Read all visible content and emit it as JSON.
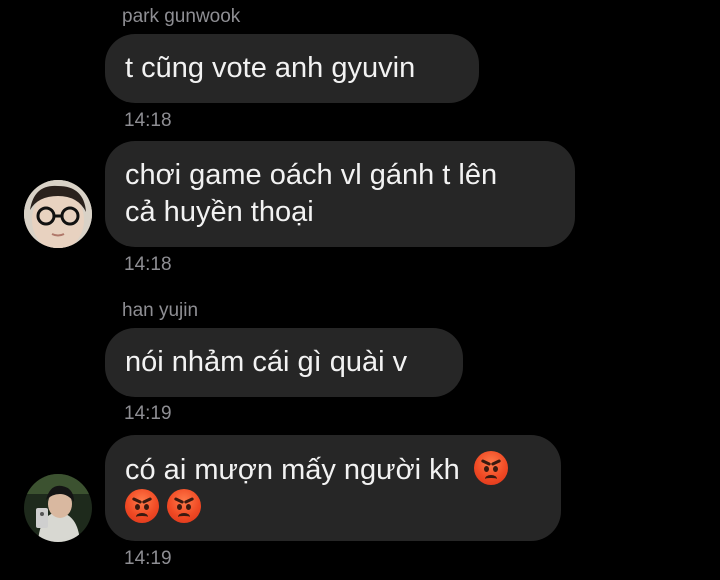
{
  "messages": [
    {
      "sender": "park gunwook",
      "text_lines": [
        "t cũng vote anh gyuvin"
      ],
      "time": "14:18"
    },
    {
      "sender": "",
      "text_lines": [
        "chơi game oách vl gánh t lên",
        "cả huyền thoại"
      ],
      "time": "14:18",
      "avatar": "avatar-glasses"
    },
    {
      "sender": "han yujin",
      "text_lines": [
        "nói nhảm cái gì quài v"
      ],
      "time": "14:19"
    },
    {
      "sender": "",
      "text_lines": [
        "có ai mượn mấy người kh"
      ],
      "time": "14:19",
      "avatar": "avatar-mirror-selfie",
      "emoji": [
        "angry-face-icon",
        "angry-face-icon",
        "angry-face-icon"
      ]
    }
  ],
  "colors": {
    "background": "#000000",
    "bubble": "#262626",
    "text": "#f2f2f2",
    "meta": "#8e8e93",
    "emoji": "#f04a24"
  }
}
